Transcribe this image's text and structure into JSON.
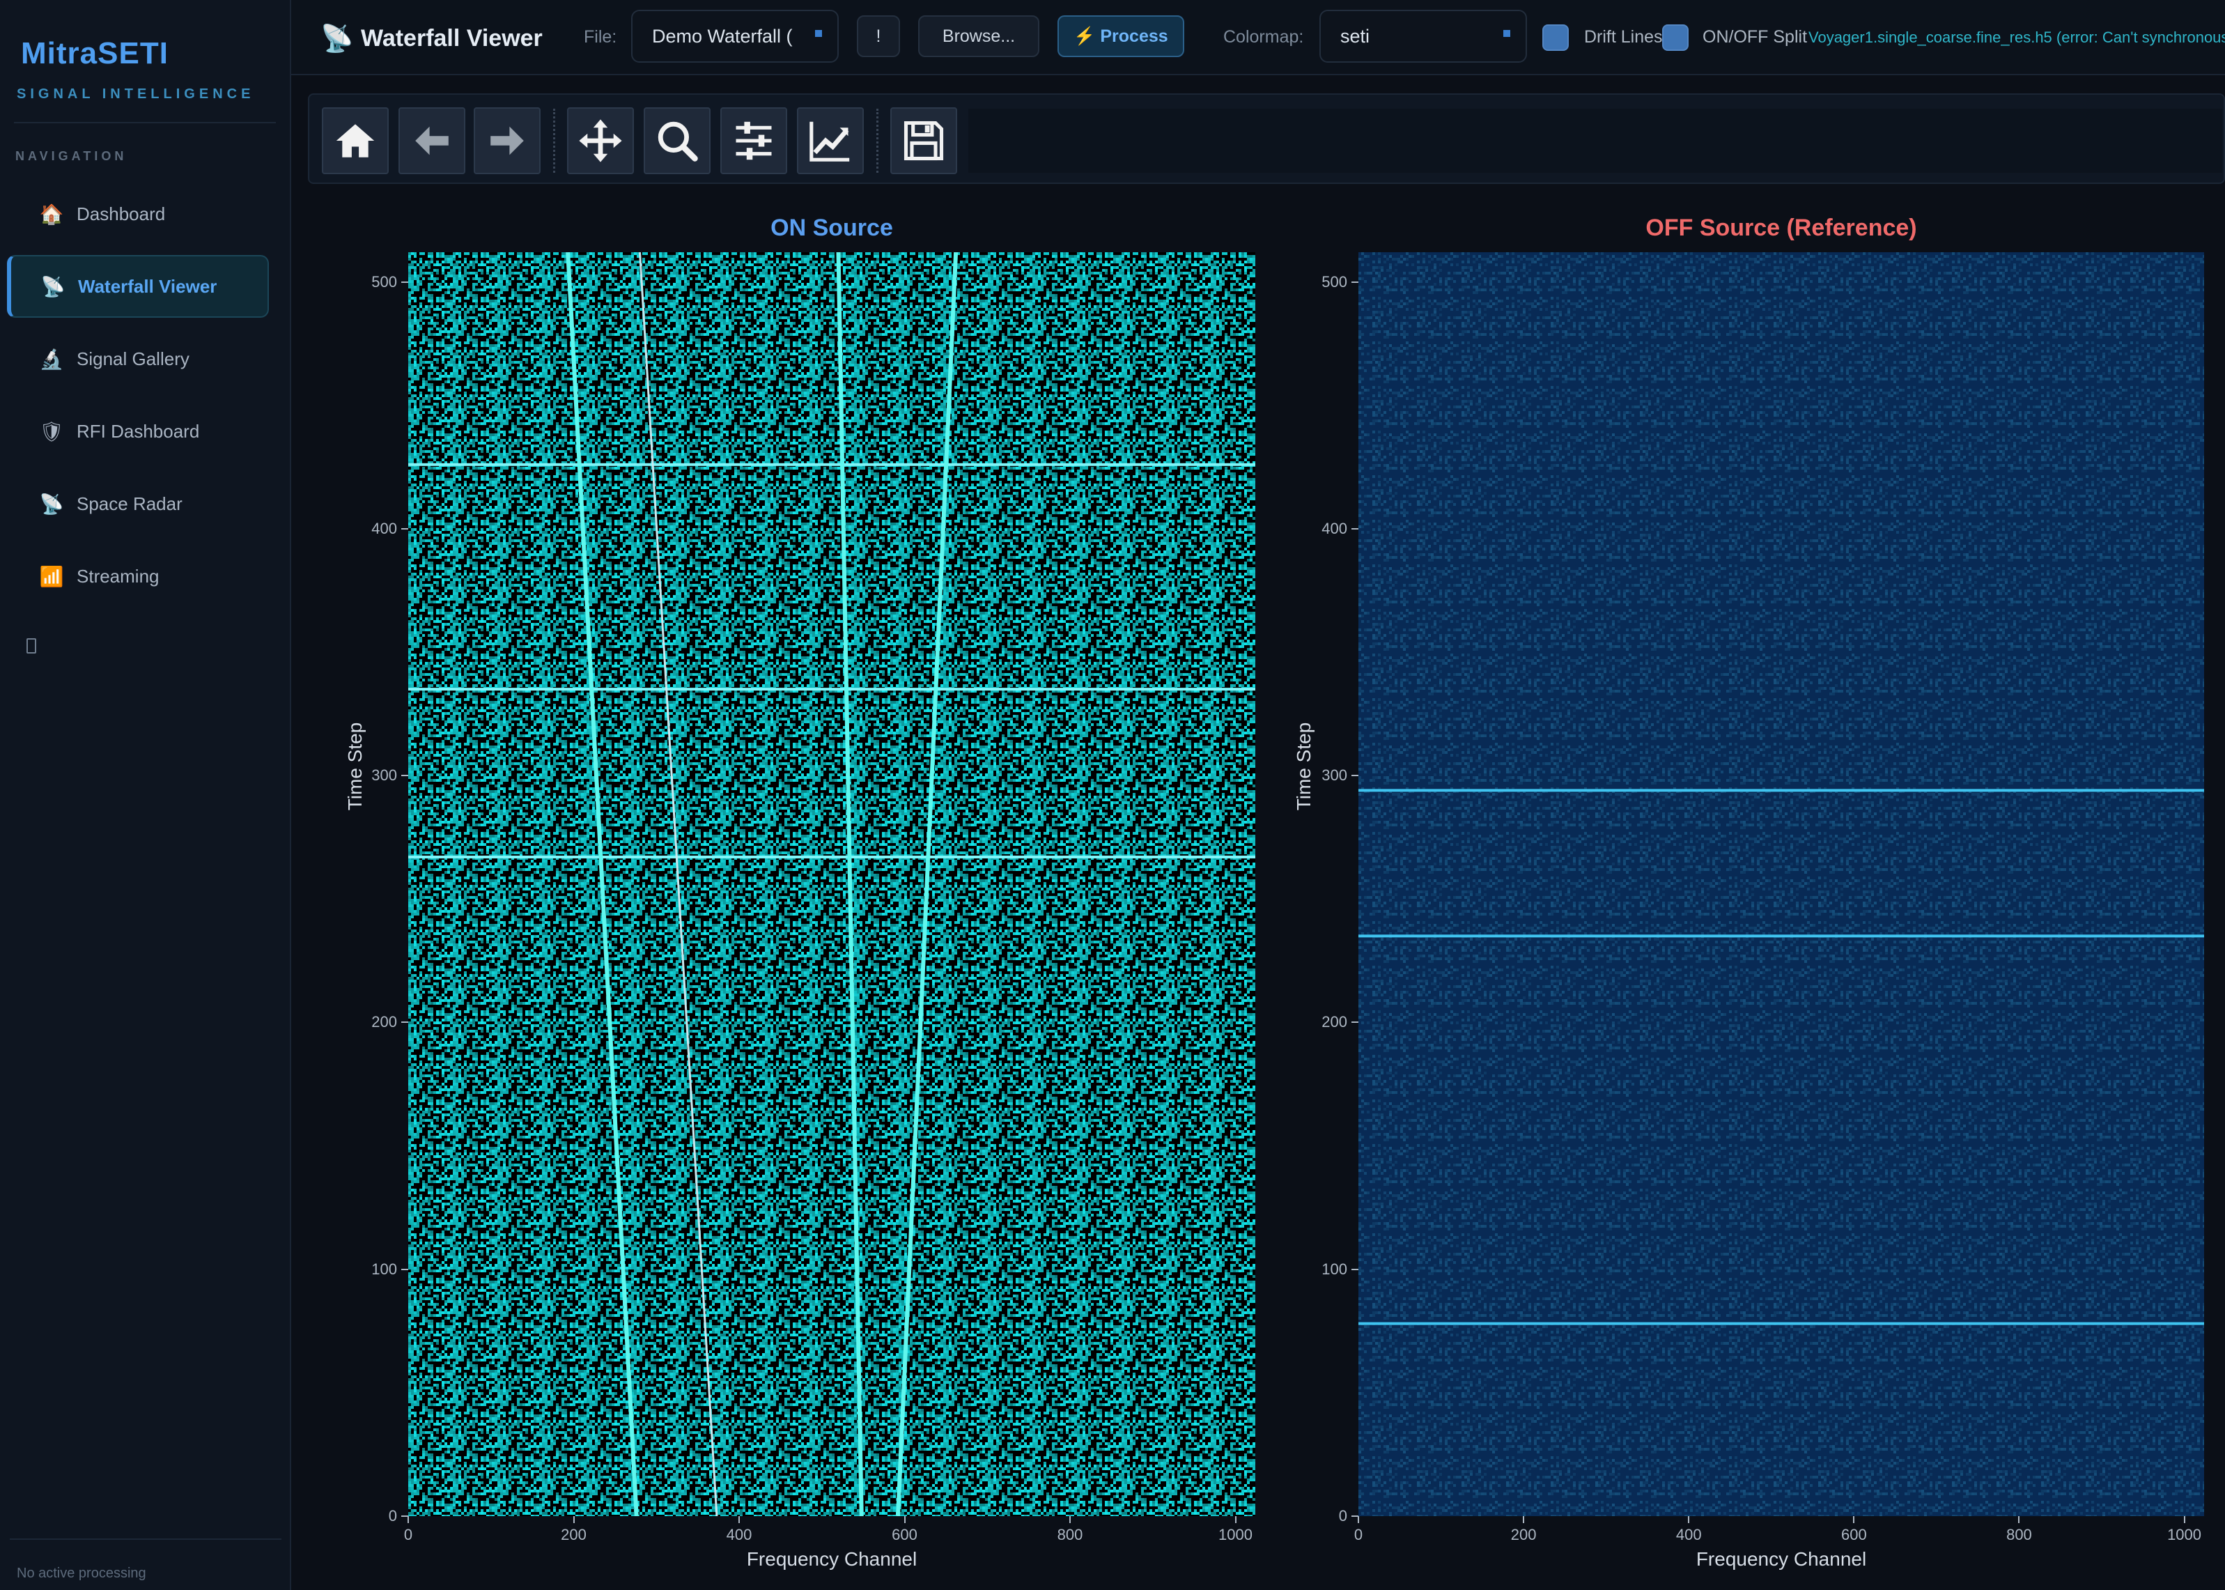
{
  "sidebar": {
    "brand": "MitraSETI",
    "tagline": "SIGNAL INTELLIGENCE",
    "nav_heading": "NAVIGATION",
    "items": [
      {
        "label": "Dashboard",
        "icon": "🏠"
      },
      {
        "label": "Waterfall Viewer",
        "icon": "📡"
      },
      {
        "label": "Signal Gallery",
        "icon": "🔬"
      },
      {
        "label": "RFI Dashboard",
        "icon": "🛡"
      },
      {
        "label": "Space Radar",
        "icon": "📡"
      },
      {
        "label": "Streaming",
        "icon": "📶"
      }
    ],
    "active_item": "Waterfall Viewer",
    "footer_status": "No active processing"
  },
  "toolbar": {
    "app_icon": "📡",
    "title": "Waterfall Viewer",
    "file_label": "File:",
    "file_value": "Demo Waterfall (",
    "info_button": "!",
    "browse_button": "Browse...",
    "process_button": "⚡ Process",
    "colormap_label": "Colormap:",
    "colormap_value": "seti",
    "drift_lines_label": "Drift Lines",
    "drift_lines_checked": true,
    "onoff_label": "ON/OFF Split",
    "onoff_checked": true,
    "status_text": "Voyager1.single_coarse.fine_res.h5 (error: Can't synchronous"
  },
  "plot_toolbar": {
    "tools": [
      "home-icon",
      "back-arrow-icon",
      "forward-arrow-icon",
      "pan-icon",
      "zoom-icon",
      "configure-subplots-icon",
      "edit-axis-icon",
      "save-icon"
    ]
  },
  "chart_data": [
    {
      "type": "heatmap",
      "title": "ON Source",
      "title_color": "#5b9ff0",
      "xlabel": "Frequency Channel",
      "ylabel": "Time Step",
      "xlim": [
        0,
        1024
      ],
      "ylim": [
        0,
        512
      ],
      "xticks": [
        0,
        200,
        400,
        600,
        800,
        1000
      ],
      "yticks": [
        0,
        100,
        200,
        300,
        400,
        500
      ],
      "colormap": "seti",
      "colors": {
        "low": "#000000",
        "high": "#12e3e8"
      },
      "horizontal_signals_timestep": [
        267,
        335,
        426
      ],
      "drift_signals": [
        {
          "start_channel": 276,
          "end_channel": 193,
          "brightness": "bright"
        },
        {
          "start_channel": 373,
          "end_channel": 280,
          "brightness": "dim"
        },
        {
          "start_channel": 548,
          "end_channel": 520,
          "brightness": "bright"
        },
        {
          "start_channel": 592,
          "end_channel": 662,
          "brightness": "bright"
        }
      ]
    },
    {
      "type": "heatmap",
      "title": "OFF Source (Reference)",
      "title_color": "#f06a6a",
      "xlabel": "Frequency Channel",
      "ylabel": "Time Step",
      "xlim": [
        0,
        1024
      ],
      "ylim": [
        0,
        512
      ],
      "xticks": [
        0,
        200,
        400,
        600,
        800,
        1000
      ],
      "yticks": [
        0,
        100,
        200,
        300,
        400,
        500
      ],
      "colormap": "seti",
      "colors": {
        "low": "#082a55",
        "high": "#3fbff0"
      },
      "horizontal_signals_timestep": [
        78,
        235,
        294
      ]
    }
  ]
}
